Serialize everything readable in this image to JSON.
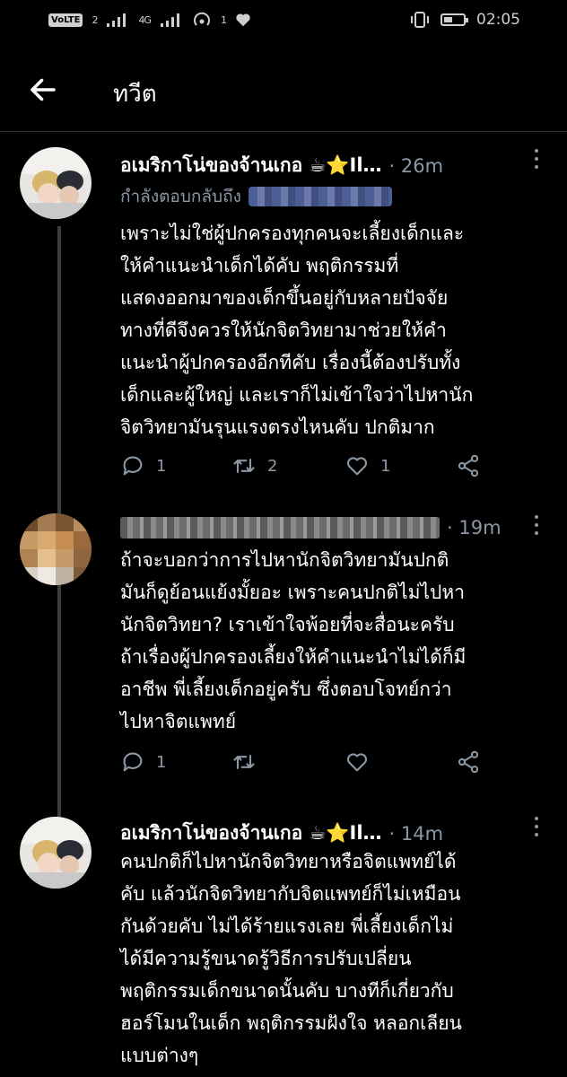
{
  "status_bar": {
    "volte": "VoLTE",
    "sim": "2",
    "network": "4G",
    "wifi_badge": "1",
    "time": "02:05"
  },
  "header": {
    "title": "ทวีต"
  },
  "tweets": [
    {
      "name": "อเมริกาโน่ของจ้านเกอ ☕⭐Il…",
      "time": "· 26m",
      "reply_label": "กำลังตอบกลับถึง",
      "lines": [
        "เพราะไม่ใช่ผู้ปกครองทุกคนจะเลี้ยงเด็กและ",
        "ให้คำแนะนำเด็กได้คับ พฤติกรรมที่",
        "แสดงออกมาของเด็กขึ้นอยู่กับหลายปัจจัย",
        "ทางที่ดีจึงควรให้นักจิตวิทยามาช่วยให้คำ",
        "แนะนำผู้ปกครองอีกทีคับ เรื่องนี้ต้องปรับทั้ง",
        "เด็กและผู้ใหญ่ และเราก็ไม่เข้าใจว่าไปหานัก",
        "จิตวิทยามันรุนแรงตรงไหนคับ ปกติมาก"
      ],
      "replies": "1",
      "retweets": "2",
      "likes": "1"
    },
    {
      "name": "",
      "time": "· 19m",
      "lines": [
        "ถ้าจะบอกว่าการไปหานักจิตวิทยามันปกติ",
        "มันก็ดูย้อนแย้งมั้ยอะ เพราะคนปกติไม่ไปหา",
        "นักจิตวิทยา? เราเข้าใจพ้อยที่จะสื่อนะครับ",
        "ถ้าเรื่องผู้ปกครองเลี้ยงให้คำแนะนำไม่ได้ก็มี",
        "อาชีพ พี่เลี้ยงเด็กอยู่ครับ ซึ่งตอบโจทย์กว่า",
        "ไปหาจิตแพทย์"
      ],
      "replies": "1",
      "retweets": "",
      "likes": ""
    },
    {
      "name": "อเมริกาโน่ของจ้านเกอ ☕⭐Il…",
      "time": "· 14m",
      "lines": [
        "คนปกติก็ไปหานักจิตวิทยาหรือจิตแพทย์ได้",
        "คับ แล้วนักจิตวิทยากับจิตแพทย์ก็ไม่เหมือน",
        "กันด้วยคับ ไม่ได้ร้ายแรงเลย พี่เลี้ยงเด็กไม่",
        "ได้มีความรู้ขนาดรู้วิธีการปรับเปลี่ยน",
        "พฤติกรรมเด็กขนาดนั้นคับ บางทีก็เกี่ยวกับ",
        "ฮอร์โมนในเด็ก พฤติกรรมฝังใจ หลอกเลียน",
        "แบบต่างๆ"
      ]
    }
  ],
  "icons": {
    "reply": "reply-icon",
    "retweet": "retweet-icon",
    "like": "heart-icon",
    "share": "share-icon",
    "more": "more-vertical-icon",
    "back": "back-arrow-icon"
  },
  "colors": {
    "background": "#000000",
    "secondary_text": "#8b98a5",
    "thread_line": "#3d3d3d"
  }
}
